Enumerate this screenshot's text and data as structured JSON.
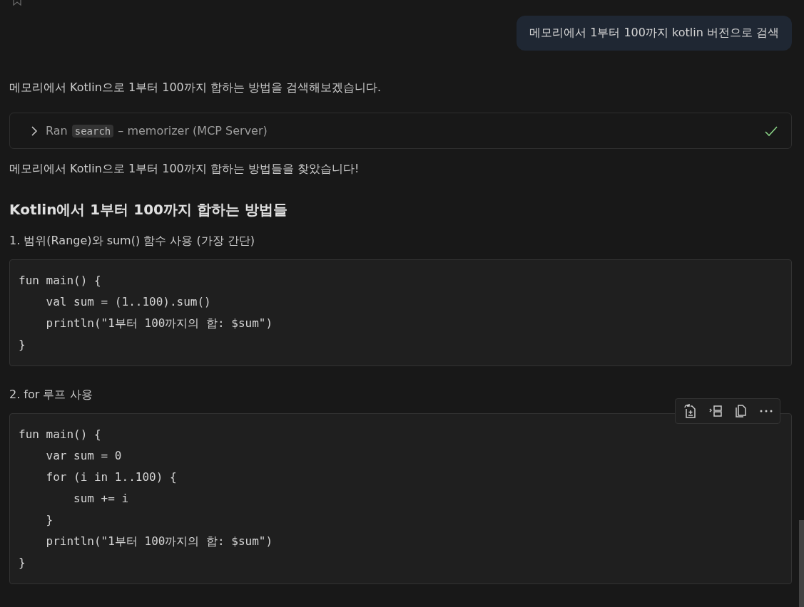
{
  "user_message": {
    "text": "메모리에서 1부터 100까지 kotlin 버전으로 검색"
  },
  "blocks": [
    {
      "kind": "paragraph",
      "text": "메모리에서 Kotlin으로 1부터 100까지 합하는 방법을 검색해보겠습니다."
    },
    {
      "kind": "tool",
      "verb": "Ran",
      "tool": "search",
      "source": "– memorizer (MCP Server)",
      "expanded": false,
      "completed": true
    },
    {
      "kind": "paragraph",
      "text": "메모리에서 Kotlin으로 1부터 100까지 합하는 방법들을 찾았습니다!"
    },
    {
      "kind": "heading",
      "text": "Kotlin에서 1부터 100까지 합하는 방법들"
    },
    {
      "kind": "paragraph",
      "text": "1. 범위(Range)와 sum() 함수 사용 (가장 간단)"
    },
    {
      "kind": "code",
      "toolbar": false,
      "lines": [
        "fun main() {",
        "    val sum = (1..100).sum()",
        "    println(\"1부터 100까지의 합: $sum\")",
        "}"
      ]
    },
    {
      "kind": "paragraph",
      "text": "2. for 루프 사용"
    },
    {
      "kind": "code",
      "toolbar": true,
      "lines": [
        "fun main() {",
        "    var sum = 0",
        "    for (i in 1..100) {",
        "        sum += i",
        "    }",
        "    println(\"1부터 100까지의 합: $sum\")",
        "}"
      ]
    }
  ]
}
